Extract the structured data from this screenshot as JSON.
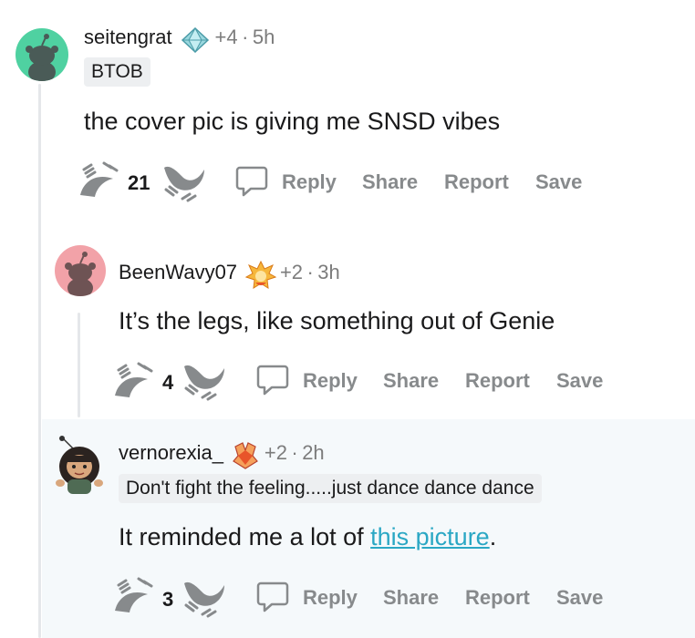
{
  "comments": [
    {
      "username": "seitengrat",
      "karma": "+4",
      "time": "5h",
      "flair": "BTOB",
      "body": "the cover pic is giving me SNSD vibes",
      "score": "21",
      "actions": {
        "reply": "Reply",
        "share": "Share",
        "report": "Report",
        "save": "Save"
      },
      "avatar_color": "#4fd1a1",
      "award_icon": "crystal-award-icon"
    },
    {
      "username": "BeenWavy07",
      "karma": "+2",
      "time": "3h",
      "body": "It’s the legs, like something out of Genie",
      "score": "4",
      "actions": {
        "reply": "Reply",
        "share": "Share",
        "report": "Report",
        "save": "Save"
      },
      "avatar_color": "#f2a2a8",
      "award_icon": "fire-award-icon"
    },
    {
      "username": "vernorexia_",
      "karma": "+2",
      "time": "2h",
      "flair": "Don't fight the feeling.....just dance dance dance",
      "body_prefix": "It reminded me a lot of ",
      "body_link": "this picture",
      "body_suffix": ".",
      "score": "3",
      "actions": {
        "reply": "Reply",
        "share": "Share",
        "report": "Report",
        "save": "Save"
      },
      "avatar_color": "#ffffff",
      "award_icon": "gem-award-icon"
    }
  ],
  "separator": "·",
  "colors": {
    "link": "#2aa7c4",
    "muted": "#878a8c",
    "highlight": "#f5f9fb"
  }
}
